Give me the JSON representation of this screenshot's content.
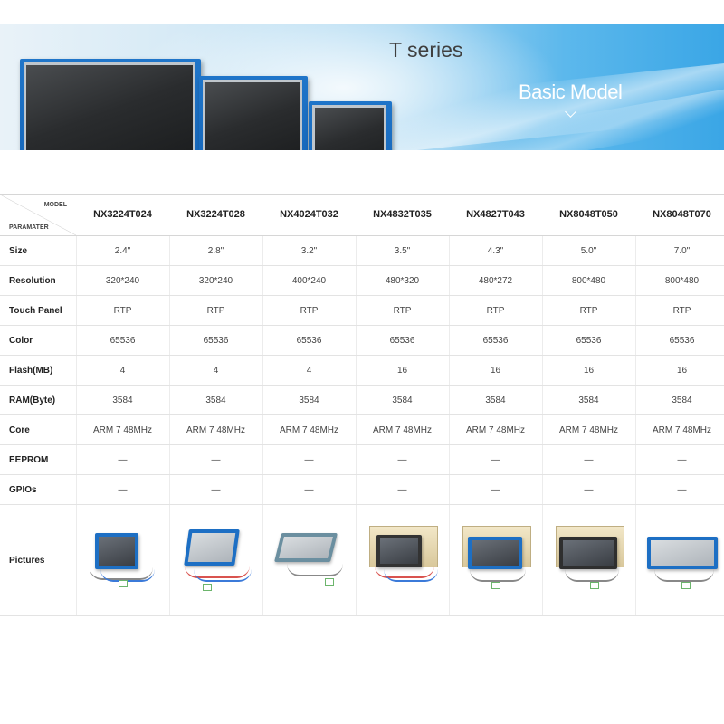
{
  "banner": {
    "title": "T series",
    "subtitle": "Basic Model"
  },
  "table": {
    "corner_model": "MODEL",
    "corner_param": "PARAMATER",
    "models": [
      "NX3224T024",
      "NX3224T028",
      "NX4024T032",
      "NX4832T035",
      "NX4827T043",
      "NX8048T050",
      "NX8048T070"
    ],
    "rows": [
      {
        "label": "Size",
        "values": [
          "2.4\"",
          "2.8\"",
          "3.2\"",
          "3.5\"",
          "4.3\"",
          "5.0\"",
          "7.0\""
        ]
      },
      {
        "label": "Resolution",
        "values": [
          "320*240",
          "320*240",
          "400*240",
          "480*320",
          "480*272",
          "800*480",
          "800*480"
        ]
      },
      {
        "label": "Touch Panel",
        "values": [
          "RTP",
          "RTP",
          "RTP",
          "RTP",
          "RTP",
          "RTP",
          "RTP"
        ]
      },
      {
        "label": "Color",
        "values": [
          "65536",
          "65536",
          "65536",
          "65536",
          "65536",
          "65536",
          "65536"
        ]
      },
      {
        "label": "Flash(MB)",
        "values": [
          "4",
          "4",
          "4",
          "16",
          "16",
          "16",
          "16"
        ]
      },
      {
        "label": "RAM(Byte)",
        "values": [
          "3584",
          "3584",
          "3584",
          "3584",
          "3584",
          "3584",
          "3584"
        ]
      },
      {
        "label": "Core",
        "values": [
          "ARM 7 48MHz",
          "ARM 7 48MHz",
          "ARM 7 48MHz",
          "ARM 7 48MHz",
          "ARM 7 48MHz",
          "ARM 7 48MHz",
          "ARM 7 48MHz"
        ]
      },
      {
        "label": "EEPROM",
        "values": [
          "—",
          "—",
          "—",
          "—",
          "—",
          "—",
          "—"
        ]
      },
      {
        "label": "GPIOs",
        "values": [
          "—",
          "—",
          "—",
          "—",
          "—",
          "—",
          "—"
        ]
      }
    ],
    "pictures_label": "Pictures"
  },
  "colors": {
    "accent_blue": "#1d6fc4",
    "banner_blue": "#3aa6e6"
  }
}
